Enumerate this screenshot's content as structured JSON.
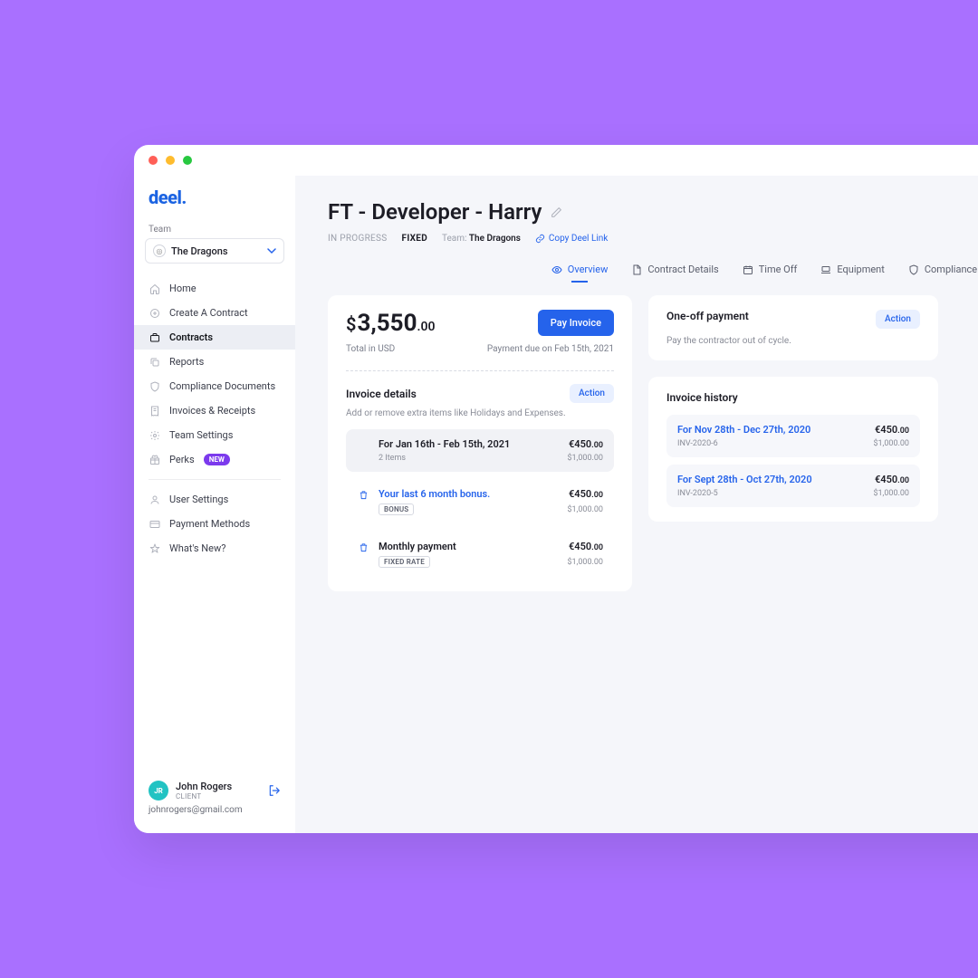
{
  "brand": {
    "logo_text": "deel."
  },
  "sidebar": {
    "team_label": "Team",
    "team_name": "The Dragons",
    "nav": [
      {
        "label": "Home",
        "icon": "home"
      },
      {
        "label": "Create A Contract",
        "icon": "plus-circle"
      },
      {
        "label": "Contracts",
        "icon": "briefcase"
      },
      {
        "label": "Reports",
        "icon": "copy"
      },
      {
        "label": "Compliance Documents",
        "icon": "shield"
      },
      {
        "label": "Invoices & Receipts",
        "icon": "receipt"
      },
      {
        "label": "Team Settings",
        "icon": "gear"
      },
      {
        "label": "Perks",
        "icon": "gift",
        "badge": "NEW"
      }
    ],
    "nav2": [
      {
        "label": "User Settings",
        "icon": "user"
      },
      {
        "label": "Payment Methods",
        "icon": "card"
      },
      {
        "label": "What's New?",
        "icon": "star"
      }
    ],
    "active_index": 2
  },
  "user": {
    "initials": "JR",
    "name": "John Rogers",
    "role": "CLIENT",
    "email": "johnrogers@gmail.com"
  },
  "page": {
    "title": "FT - Developer - Harry",
    "status": "IN PROGRESS",
    "rate_type": "FIXED",
    "team_label": "Team:",
    "team_name": "The Dragons",
    "copy_link": "Copy Deel Link"
  },
  "tabs": {
    "items": [
      {
        "label": "Overview",
        "icon": "eye"
      },
      {
        "label": "Contract Details",
        "icon": "doc"
      },
      {
        "label": "Time Off",
        "icon": "calendar"
      },
      {
        "label": "Equipment",
        "icon": "laptop"
      },
      {
        "label": "Compliance Documents",
        "icon": "shield"
      }
    ],
    "active_index": 0
  },
  "overview": {
    "currency_symbol": "$",
    "amount_int": "3,550",
    "amount_dec": ".00",
    "pay_button": "Pay Invoice",
    "total_label": "Total in USD",
    "due_label": "Payment due on Feb 15th, 2021",
    "details_title": "Invoice details",
    "details_action": "Action",
    "details_sub": "Add or remove extra items like Holidays and Expenses.",
    "items": [
      {
        "type": "period",
        "title": "For Jan 16th - Feb 15th, 2021",
        "sub": "2 Items",
        "amount_int": "€450",
        "amount_dec": ".00",
        "sub_amount_int": "$1,000",
        "sub_amount_dec": ".00"
      },
      {
        "type": "bonus",
        "title": "Your last 6 month bonus.",
        "pill": "BONUS",
        "amount_int": "€450",
        "amount_dec": ".00",
        "sub_amount_int": "$1,000",
        "sub_amount_dec": ".00"
      },
      {
        "type": "fixed",
        "title": "Monthly payment",
        "pill": "FIXED RATE",
        "amount_int": "€450",
        "amount_dec": ".00",
        "sub_amount_int": "$1,000",
        "sub_amount_dec": ".00"
      }
    ]
  },
  "oneoff": {
    "title": "One-off payment",
    "action": "Action",
    "sub": "Pay the contractor out of cycle."
  },
  "history": {
    "title": "Invoice history",
    "items": [
      {
        "title": "For Nov 28th - Dec 27th, 2020",
        "sub": "INV-2020-6",
        "amount_int": "€450",
        "amount_dec": ".00",
        "sub_amount_int": "$1,000",
        "sub_amount_dec": ".00"
      },
      {
        "title": "For Sept 28th - Oct 27th, 2020",
        "sub": "INV-2020-5",
        "amount_int": "€450",
        "amount_dec": ".00",
        "sub_amount_int": "$1,000",
        "sub_amount_dec": ".00"
      }
    ]
  }
}
